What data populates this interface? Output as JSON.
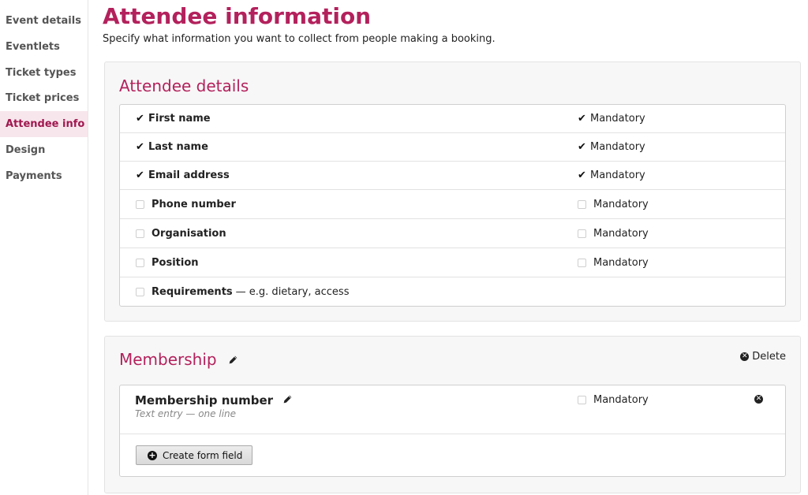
{
  "sidebar": {
    "items": [
      {
        "label": "Event details"
      },
      {
        "label": "Eventlets"
      },
      {
        "label": "Ticket types"
      },
      {
        "label": "Ticket prices"
      },
      {
        "label": "Attendee info",
        "active": true
      },
      {
        "label": "Design"
      },
      {
        "label": "Payments"
      }
    ]
  },
  "page": {
    "title": "Attendee information",
    "subtitle": "Specify what information you want to collect from people making a booking."
  },
  "attendee_details": {
    "title": "Attendee details",
    "mandatory_label": "Mandatory",
    "fields": [
      {
        "label": "First name",
        "included": true,
        "mandatory": true
      },
      {
        "label": "Last name",
        "included": true,
        "mandatory": true
      },
      {
        "label": "Email address",
        "included": true,
        "mandatory": true
      },
      {
        "label": "Phone number",
        "included": false,
        "mandatory": false
      },
      {
        "label": "Organisation",
        "included": false,
        "mandatory": false
      },
      {
        "label": "Position",
        "included": false,
        "mandatory": false
      },
      {
        "label": "Requirements",
        "hint": "— e.g. dietary, access",
        "included": false
      }
    ]
  },
  "membership": {
    "title": "Membership",
    "delete_label": "Delete",
    "field": {
      "name": "Membership number",
      "description": "Text entry — one line",
      "mandatory_label": "Mandatory",
      "mandatory": false
    },
    "create_button_label": "Create form field"
  },
  "colors": {
    "accent": "#b3215c",
    "active_nav_bg": "#f7e6ec"
  },
  "icons": {
    "check": "check-icon",
    "pencil": "pencil-icon",
    "delete": "circle-x-icon",
    "add": "circle-plus-icon"
  }
}
